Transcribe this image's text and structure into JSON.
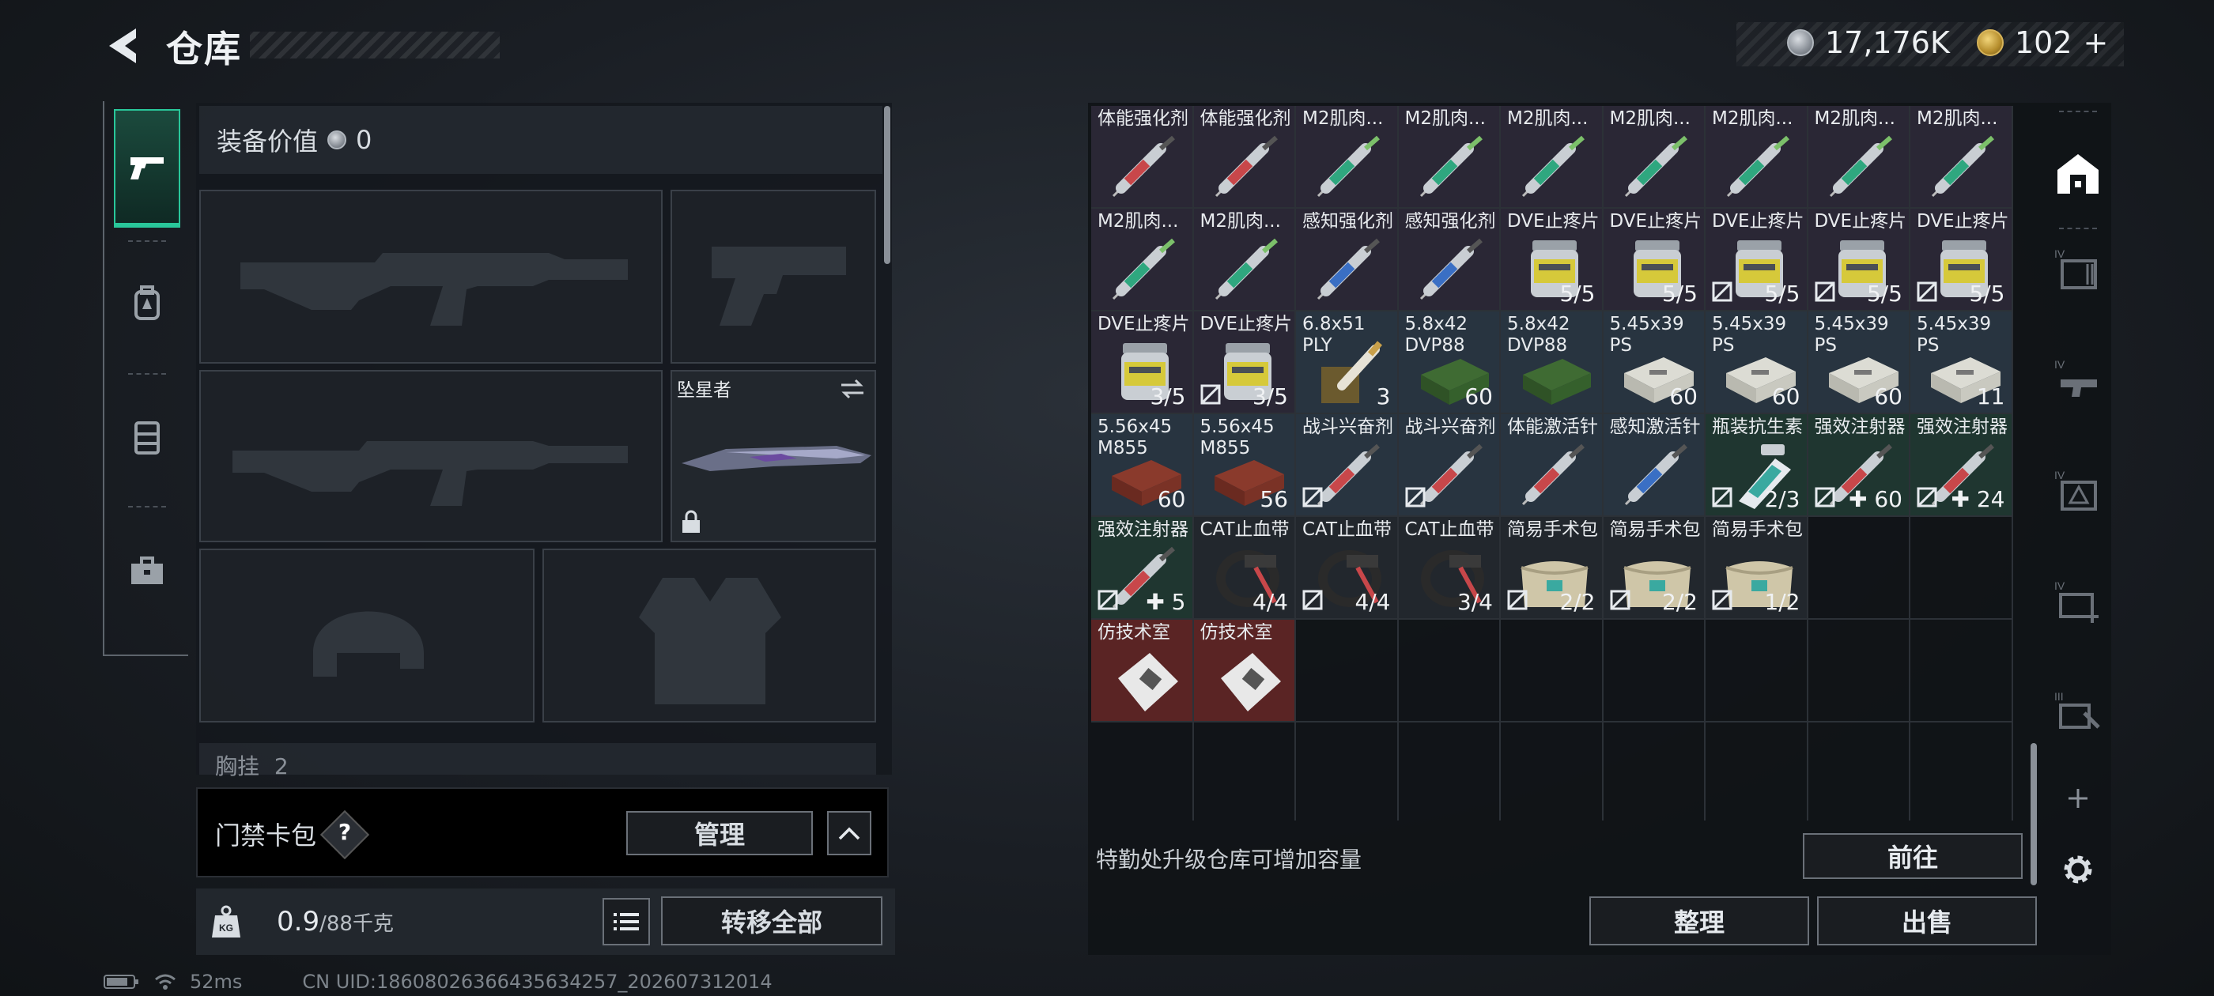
{
  "header": {
    "title": "仓库",
    "silver": "17,176K",
    "gold": "102",
    "gold_add": "+"
  },
  "left_tabs": [
    {
      "id": "weapons",
      "icon": "pistol-icon",
      "active": true
    },
    {
      "id": "armor",
      "icon": "backpack-icon",
      "active": false
    },
    {
      "id": "rig",
      "icon": "chest-rig-icon",
      "active": false
    },
    {
      "id": "case",
      "icon": "briefcase-icon",
      "active": false
    }
  ],
  "loadout": {
    "equip_value_label": "装备价值",
    "equip_value": "0",
    "melee_name": "坠星者",
    "chest_label": "胸挂",
    "chest_value": "2"
  },
  "keycard": {
    "label": "门禁卡包",
    "help": "?",
    "manage": "管理"
  },
  "weight": {
    "current": "0.9",
    "max": "/88千克",
    "transfer_all": "转移全部"
  },
  "status": {
    "ping": "52ms",
    "uid": "CN UID:18608026366435634257_202607312014"
  },
  "stash": {
    "items": [
      {
        "n1": "体能强化剂",
        "n2": "",
        "c": "",
        "bg": "purple",
        "art": "syringe-red",
        "locked": false
      },
      {
        "n1": "体能强化剂",
        "n2": "",
        "c": "",
        "bg": "purple",
        "art": "syringe-red",
        "locked": false
      },
      {
        "n1": "M2肌肉...",
        "n2": "",
        "c": "",
        "bg": "purple",
        "art": "syringe-green",
        "locked": false
      },
      {
        "n1": "M2肌肉...",
        "n2": "",
        "c": "",
        "bg": "purple",
        "art": "syringe-green",
        "locked": false
      },
      {
        "n1": "M2肌肉...",
        "n2": "",
        "c": "",
        "bg": "purple",
        "art": "syringe-green",
        "locked": false
      },
      {
        "n1": "M2肌肉...",
        "n2": "",
        "c": "",
        "bg": "purple",
        "art": "syringe-green",
        "locked": false
      },
      {
        "n1": "M2肌肉...",
        "n2": "",
        "c": "",
        "bg": "purple",
        "art": "syringe-green",
        "locked": false
      },
      {
        "n1": "M2肌肉...",
        "n2": "",
        "c": "",
        "bg": "purple",
        "art": "syringe-green",
        "locked": false
      },
      {
        "n1": "M2肌肉...",
        "n2": "",
        "c": "",
        "bg": "purple",
        "art": "syringe-green",
        "locked": false
      },
      {
        "n1": "M2肌肉...",
        "n2": "",
        "c": "",
        "bg": "purple",
        "art": "syringe-green",
        "locked": false
      },
      {
        "n1": "M2肌肉...",
        "n2": "",
        "c": "",
        "bg": "purple",
        "art": "syringe-green",
        "locked": false
      },
      {
        "n1": "感知强化剂",
        "n2": "",
        "c": "",
        "bg": "purple",
        "art": "syringe-blue",
        "locked": false
      },
      {
        "n1": "感知强化剂",
        "n2": "",
        "c": "",
        "bg": "purple",
        "art": "syringe-blue",
        "locked": false
      },
      {
        "n1": "DVE止疼片",
        "n2": "",
        "c": "5/5",
        "bg": "purple",
        "art": "pills",
        "locked": false
      },
      {
        "n1": "DVE止疼片",
        "n2": "",
        "c": "5/5",
        "bg": "purple",
        "art": "pills",
        "locked": false
      },
      {
        "n1": "DVE止疼片",
        "n2": "",
        "c": "5/5",
        "bg": "purple",
        "art": "pills",
        "locked": true
      },
      {
        "n1": "DVE止疼片",
        "n2": "",
        "c": "5/5",
        "bg": "purple",
        "art": "pills",
        "locked": true
      },
      {
        "n1": "DVE止疼片",
        "n2": "",
        "c": "5/5",
        "bg": "purple",
        "art": "pills",
        "locked": true
      },
      {
        "n1": "DVE止疼片",
        "n2": "",
        "c": "3/5",
        "bg": "purple",
        "art": "pills",
        "locked": false
      },
      {
        "n1": "DVE止疼片",
        "n2": "",
        "c": "3/5",
        "bg": "purple",
        "art": "pills",
        "locked": true
      },
      {
        "n1": "6.8x51",
        "n2": "PLY",
        "c": "3",
        "bg": "steel",
        "art": "ammo-box",
        "locked": false
      },
      {
        "n1": "5.8x42",
        "n2": "DVP88",
        "c": "60",
        "bg": "steel",
        "art": "ammo-green",
        "locked": false
      },
      {
        "n1": "5.8x42",
        "n2": "DVP88",
        "c": "",
        "bg": "steel",
        "art": "ammo-green",
        "locked": false
      },
      {
        "n1": "5.45x39",
        "n2": "PS",
        "c": "60",
        "bg": "steel",
        "art": "ammo-white",
        "locked": false
      },
      {
        "n1": "5.45x39",
        "n2": "PS",
        "c": "60",
        "bg": "steel",
        "art": "ammo-white",
        "locked": false
      },
      {
        "n1": "5.45x39",
        "n2": "PS",
        "c": "60",
        "bg": "steel",
        "art": "ammo-white",
        "locked": false
      },
      {
        "n1": "5.45x39",
        "n2": "PS",
        "c": "11",
        "bg": "steel",
        "art": "ammo-white",
        "locked": false
      },
      {
        "n1": "5.56x45",
        "n2": "M855",
        "c": "60",
        "bg": "steel",
        "art": "ammo-red",
        "locked": false
      },
      {
        "n1": "5.56x45",
        "n2": "M855",
        "c": "56",
        "bg": "steel",
        "art": "ammo-red",
        "locked": false
      },
      {
        "n1": "战斗兴奋剂",
        "n2": "",
        "c": "",
        "bg": "steel",
        "art": "syringe-red",
        "locked": true
      },
      {
        "n1": "战斗兴奋剂",
        "n2": "",
        "c": "",
        "bg": "steel",
        "art": "syringe-red",
        "locked": true
      },
      {
        "n1": "体能激活针",
        "n2": "",
        "c": "",
        "bg": "steel",
        "art": "syringe-red",
        "locked": false
      },
      {
        "n1": "感知激活针",
        "n2": "",
        "c": "",
        "bg": "steel",
        "art": "syringe-blue",
        "locked": false
      },
      {
        "n1": "瓶装抗生素",
        "n2": "",
        "c": "2/3",
        "bg": "green",
        "art": "bottle",
        "locked": true
      },
      {
        "n1": "强效注射器",
        "n2": "",
        "c": "✚ 60",
        "bg": "green",
        "art": "syringe-red",
        "locked": true
      },
      {
        "n1": "强效注射器",
        "n2": "",
        "c": "✚ 24",
        "bg": "green",
        "art": "syringe-red",
        "locked": true
      },
      {
        "n1": "强效注射器",
        "n2": "",
        "c": "✚ 5",
        "bg": "green",
        "art": "syringe-red",
        "locked": true
      },
      {
        "n1": "CAT止血带",
        "n2": "",
        "c": "4/4",
        "bg": "dark",
        "art": "tourniquet",
        "locked": false
      },
      {
        "n1": "CAT止血带",
        "n2": "",
        "c": "4/4",
        "bg": "dark",
        "art": "tourniquet",
        "locked": true
      },
      {
        "n1": "CAT止血带",
        "n2": "",
        "c": "3/4",
        "bg": "dark",
        "art": "tourniquet",
        "locked": false
      },
      {
        "n1": "简易手术包",
        "n2": "",
        "c": "2/2",
        "bg": "dark",
        "art": "surgery-kit",
        "locked": true
      },
      {
        "n1": "简易手术包",
        "n2": "",
        "c": "2/2",
        "bg": "dark",
        "art": "surgery-kit",
        "locked": true
      },
      {
        "n1": "简易手术包",
        "n2": "",
        "c": "1/2",
        "bg": "dark",
        "art": "surgery-kit",
        "locked": true
      },
      null,
      null,
      {
        "n1": "仿技术室",
        "n2": "",
        "c": "",
        "bg": "red",
        "art": "keycard",
        "locked": false
      },
      {
        "n1": "仿技术室",
        "n2": "",
        "c": "",
        "bg": "red",
        "art": "keycard",
        "locked": false
      },
      null,
      null,
      null,
      null,
      null,
      null,
      null,
      null,
      null,
      null,
      null,
      null,
      null,
      null,
      null,
      null
    ],
    "upgrade_tip": "特勤处升级仓库可增加容量",
    "goto": "前往",
    "sort": "整理",
    "sell": "出售"
  },
  "right_rail": [
    {
      "id": "stash-main",
      "icon": "stash-icon"
    },
    {
      "id": "tier4-weapons",
      "icon": "tier-weapons-icon"
    },
    {
      "id": "tier4-gear",
      "icon": "tier-gear-icon"
    },
    {
      "id": "tier4-armor",
      "icon": "tier-armor-icon"
    },
    {
      "id": "tier4-medical",
      "icon": "tier-medical-icon"
    },
    {
      "id": "tier3-tools",
      "icon": "tier-tools-icon"
    }
  ],
  "colors": {
    "accent": "#29c79a",
    "panel": "#14181d",
    "border": "#6a7078"
  }
}
